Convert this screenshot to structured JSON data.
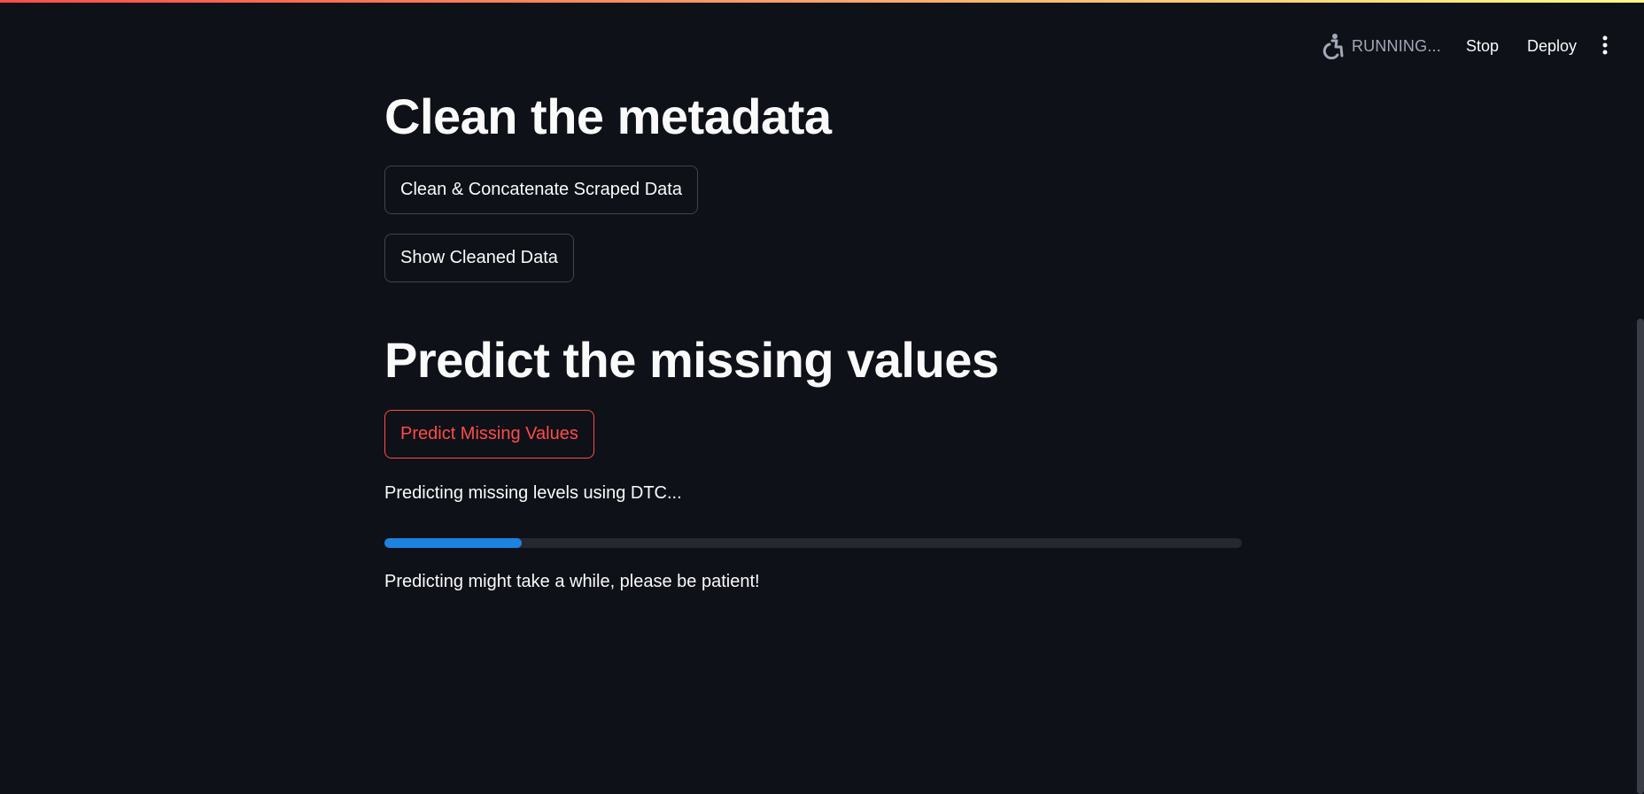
{
  "theme": {
    "background": "#0e1117",
    "text": "#fafafa",
    "muted_text": "#a3a8b8",
    "primary": "#ff4b4b",
    "progress": "#1c83e1",
    "progress_track": "#262730",
    "decoration_gradient": [
      "#ff4b4b",
      "#fffd80"
    ]
  },
  "header": {
    "status_icon": "running-person-icon",
    "status_text": "RUNNING...",
    "stop_label": "Stop",
    "deploy_label": "Deploy",
    "menu_icon": "vertical-dots-icon"
  },
  "main": {
    "section1_title": "Clean the metadata",
    "clean_button_label": "Clean & Concatenate Scraped Data",
    "show_button_label": "Show Cleaned Data",
    "section2_title": "Predict the missing values",
    "predict_button_label": "Predict Missing Values",
    "status_message": "Predicting missing levels using DTC...",
    "progress_fraction": 0.16,
    "patience_message": "Predicting might take a while, please be patient!"
  }
}
